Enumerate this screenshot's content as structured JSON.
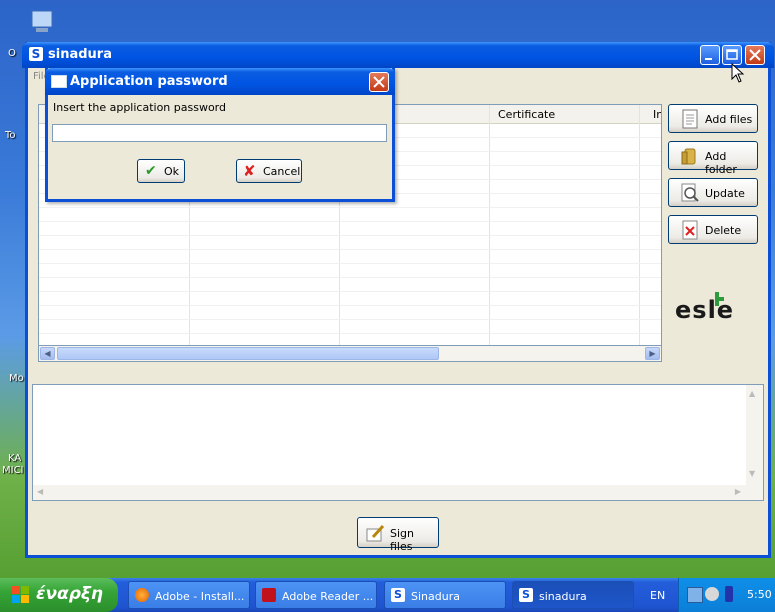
{
  "window": {
    "title": "sinadura",
    "menu_first": "File"
  },
  "desktop": {
    "icon_labels": [
      "O",
      "To",
      "Mo",
      "KA",
      "MICI"
    ]
  },
  "table": {
    "columns": [
      "",
      "",
      "",
      "Certificate",
      "In"
    ]
  },
  "sidebar_buttons": [
    {
      "label": "Add files",
      "icon": "document-icon"
    },
    {
      "label": "Add folder",
      "icon": "folder-icon"
    },
    {
      "label": "Update",
      "icon": "magnifier-icon"
    },
    {
      "label": "Delete",
      "icon": "delete-icon"
    }
  ],
  "logo_text": "esle",
  "sign_button": {
    "label": "Sign files"
  },
  "dialog": {
    "title": "Application password",
    "prompt": "Insert the application password",
    "password_value": "",
    "ok_label": "Ok",
    "cancel_label": "Cancel"
  },
  "taskbar": {
    "start_label": "έναρξη",
    "tasks": [
      {
        "label": "Adobe - Install...",
        "icon": "firefox-icon"
      },
      {
        "label": "Adobe Reader ...",
        "icon": "adobe-reader-icon"
      },
      {
        "label": "Sinadura",
        "icon": "sinadura-icon"
      },
      {
        "label": "sinadura",
        "icon": "sinadura-icon"
      }
    ],
    "language": "EN",
    "clock": "5:50"
  },
  "colors": {
    "xp_blue": "#0054e3",
    "start_green": "#36a436",
    "close_red": "#c23a15"
  }
}
